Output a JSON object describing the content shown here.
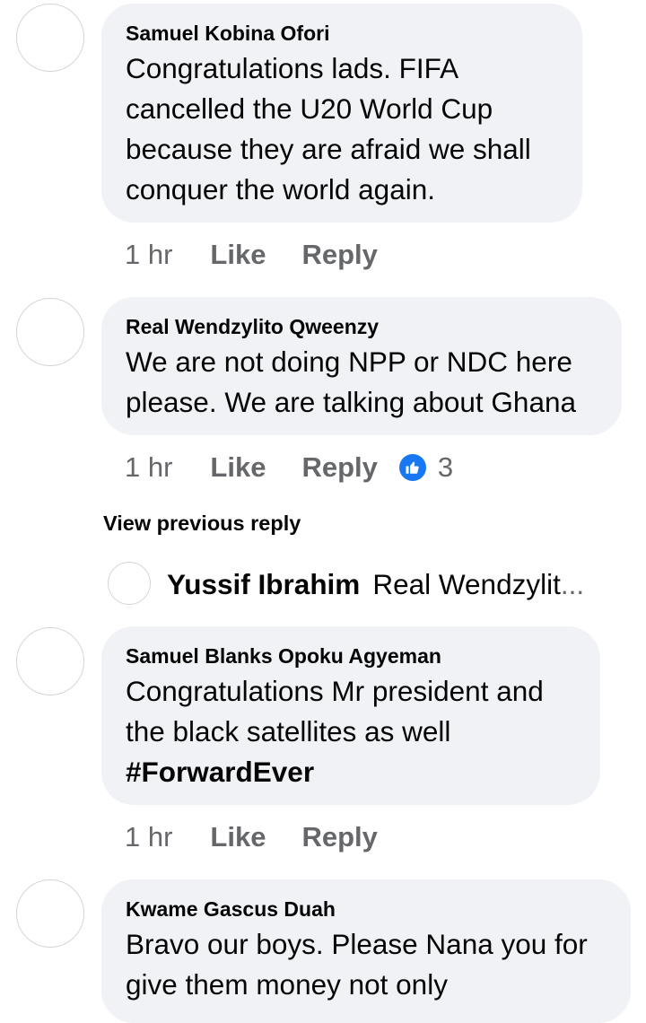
{
  "comments": [
    {
      "author": "Samuel Kobina Ofori",
      "text": "Congratulations lads. FIFA cancelled the U20 World Cup because they are afraid we shall conquer the world again.",
      "time": "1 hr",
      "like_label": "Like",
      "reply_label": "Reply"
    },
    {
      "author": "Real Wendzylito Qweenzy",
      "text": "We are not doing NPP or NDC here please. We are talking about Ghana",
      "time": "1 hr",
      "like_label": "Like",
      "reply_label": "Reply",
      "reaction_icon": "like-reaction-icon",
      "reaction_count": "3"
    },
    {
      "author": "Samuel Blanks Opoku Agyeman",
      "text": "Congratulations Mr president and the black satellites as well",
      "hashtag": "#ForwardEver",
      "time": "1 hr",
      "like_label": "Like",
      "reply_label": "Reply"
    },
    {
      "author": "Kwame Gascus Duah",
      "text": "Bravo our boys.  Please Nana you for give them money  not only"
    }
  ],
  "view_previous_reply": "View previous reply",
  "reply_preview": {
    "author": "Yussif Ibrahim",
    "text": "Real Wendzylit",
    "ellipsis": "..."
  },
  "colors": {
    "bubble": "#f0f2f5",
    "secondary_text": "#65676b",
    "like_blue": "#1877f2"
  }
}
